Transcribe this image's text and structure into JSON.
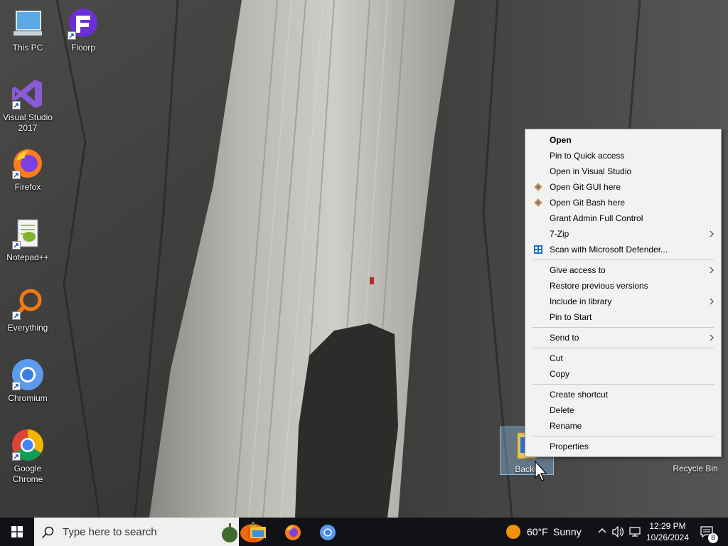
{
  "desktop": {
    "icons": [
      {
        "label": "This PC"
      },
      {
        "label": "Floorp"
      },
      {
        "label": "Visual Studio 2017"
      },
      {
        "label": "Firefox"
      },
      {
        "label": "Notepad++"
      },
      {
        "label": "Everything"
      },
      {
        "label": "Chromium"
      },
      {
        "label": "Google Chrome"
      }
    ],
    "selected_folder": {
      "label": "Backu",
      "icon": "folder-icon"
    },
    "recycle_bin": {
      "label": "Recycle Bin"
    }
  },
  "context_menu": {
    "items": [
      {
        "label": "Open",
        "bold": true
      },
      {
        "label": "Pin to Quick access"
      },
      {
        "label": "Open in Visual Studio"
      },
      {
        "label": "Open Git GUI here",
        "icon": "git-icon"
      },
      {
        "label": "Open Git Bash here",
        "icon": "git-icon"
      },
      {
        "label": "Grant Admin Full Control"
      },
      {
        "label": "7-Zip",
        "submenu": true
      },
      {
        "label": "Scan with Microsoft Defender...",
        "icon": "defender-icon"
      },
      {
        "label": "Give access to",
        "submenu": true
      },
      {
        "label": "Restore previous versions"
      },
      {
        "label": "Include in library",
        "submenu": true
      },
      {
        "label": "Pin to Start"
      },
      {
        "label": "Send to",
        "submenu": true
      },
      {
        "label": "Cut"
      },
      {
        "label": "Copy"
      },
      {
        "label": "Create shortcut"
      },
      {
        "label": "Delete"
      },
      {
        "label": "Rename"
      },
      {
        "label": "Properties"
      }
    ]
  },
  "taskbar": {
    "search_placeholder": "Type here to search",
    "pinned_apps": [
      "file-explorer-icon",
      "firefox-icon",
      "chromium-icon"
    ],
    "weather": {
      "temp": "60°F",
      "condition": "Sunny"
    },
    "clock": {
      "time": "12:29 PM",
      "date": "10/26/2024"
    },
    "notifications_count": "8"
  },
  "colors": {
    "taskbar_bg": "#101216",
    "menu_bg": "#f2f2f2",
    "selection": "#99d1ff"
  }
}
